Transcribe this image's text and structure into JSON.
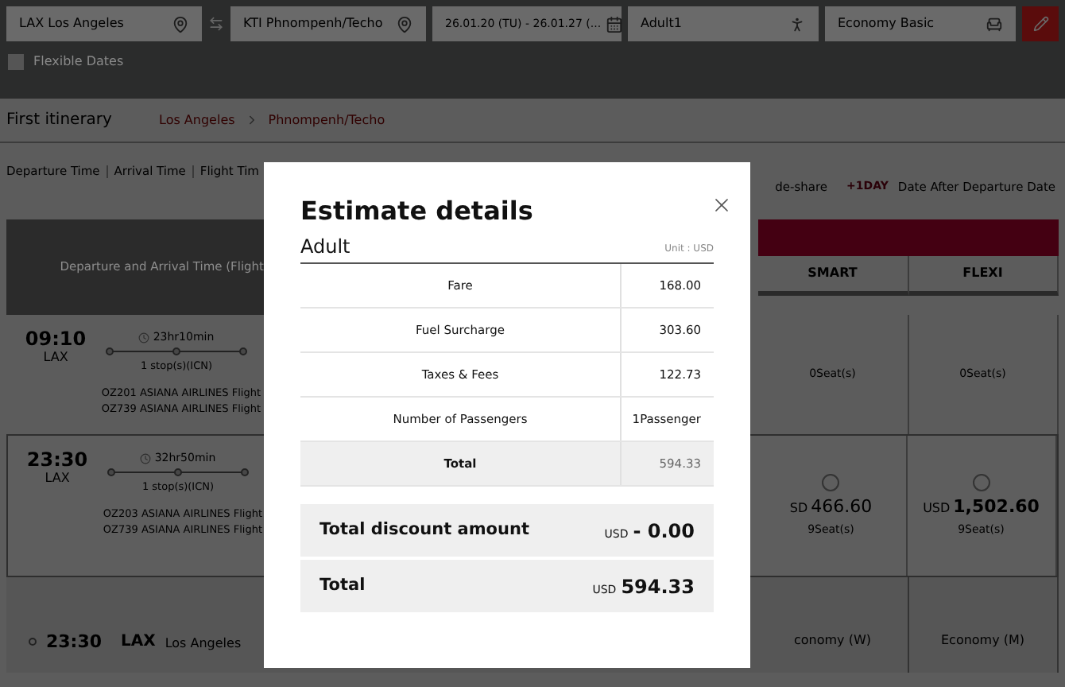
{
  "search_bar": {
    "fields": [
      {
        "kind": "location",
        "value": "LAX Los Angeles"
      },
      {
        "kind": "location",
        "value": "KTI Phnompenh/Techo"
      },
      {
        "kind": "date",
        "value": "26.01.20 (TU) - 26.01.27 (..."
      },
      {
        "kind": "passenger",
        "value": "Adult1"
      },
      {
        "kind": "seat",
        "value": "Economy Basic"
      }
    ],
    "flexible_dates": {
      "label": "Flexible Dates",
      "checked": false
    }
  },
  "itinerary": {
    "title": "First itinerary",
    "origin": "Los Angeles",
    "destination": "Phnompenh/Techo"
  },
  "sort_options": [
    "Departure Time",
    "Arrival Time",
    "Flight Tim"
  ],
  "legend": {
    "codeshare": "de-share",
    "next_day_badge": "+1DAY",
    "next_day_text": "Date After Departure Date"
  },
  "table": {
    "time_header": "Departure and Arrival Time (Flight",
    "fare_columns": [
      {
        "label": "SMART"
      },
      {
        "label": "FLEXI"
      }
    ],
    "rows": [
      {
        "kind": "flight",
        "departure": "09:10",
        "airport": "LAX",
        "duration": "23hr10min",
        "stops": "1 stop(s)(ICN)",
        "flights": [
          "OZ201 ASIANA AIRLINES Flight",
          "OZ739 ASIANA AIRLINES Flight"
        ],
        "fares": [
          {
            "seats": "0Seat(s)"
          },
          {
            "seats": "0Seat(s)"
          }
        ]
      },
      {
        "kind": "flight",
        "departure": "23:30",
        "airport": "LAX",
        "duration": "32hr50min",
        "stops": "1 stop(s)(ICN)",
        "flights": [
          "OZ203 ASIANA AIRLINES Flight",
          "OZ739 ASIANA AIRLINES Flight"
        ],
        "fares": [
          {
            "selected": false,
            "currency": "SD",
            "price": "466.60",
            "seats": "9Seat(s)"
          },
          {
            "selected": false,
            "currency": "USD",
            "price": "1,502.60",
            "seats": "9Seat(s)"
          }
        ]
      },
      {
        "kind": "segment",
        "departure": "23:30",
        "airport": "LAX",
        "city": "Los Angeles",
        "fares": [
          {
            "label": "conomy (W)"
          },
          {
            "label": "Economy (M)"
          }
        ]
      }
    ]
  },
  "modal": {
    "title": "Estimate details",
    "passenger_type": "Adult",
    "unit": "Unit : USD",
    "rows": [
      {
        "label": "Fare",
        "value": "168.00",
        "total": false
      },
      {
        "label": "Fuel Surcharge",
        "value": "303.60",
        "total": false
      },
      {
        "label": "Taxes & Fees",
        "value": "122.73",
        "total": false
      },
      {
        "label": "Number of Passengers",
        "value": "1Passenger",
        "total": false
      },
      {
        "label": "Total",
        "value": "594.33",
        "total": true
      }
    ],
    "discount": {
      "label": "Total discount amount",
      "currency": "USD",
      "amount": "- 0.00"
    },
    "grand_total": {
      "label": "Total",
      "currency": "USD",
      "amount": "594.33"
    }
  }
}
